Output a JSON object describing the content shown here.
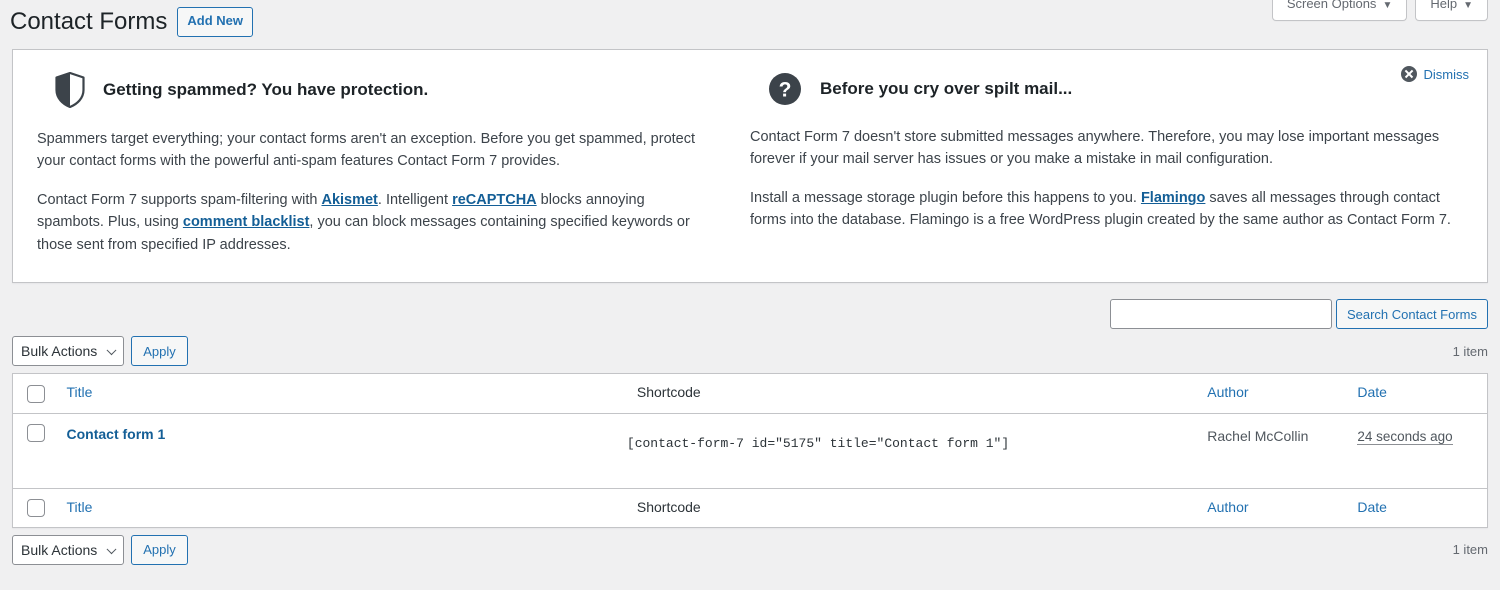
{
  "screen_meta": {
    "screen_options_label": "Screen Options",
    "help_label": "Help",
    "caret": "▼"
  },
  "header": {
    "title": "Contact Forms",
    "add_new_label": "Add New"
  },
  "notice": {
    "dismiss_label": "Dismiss",
    "columns": [
      {
        "icon": "shield-icon",
        "heading": "Getting spammed? You have protection.",
        "paragraphs": [
          {
            "parts": [
              {
                "text": "Spammers target everything; your contact forms aren't an exception. Before you get spammed, protect your contact forms with the powerful anti-spam features Contact Form 7 provides.",
                "link": false
              }
            ]
          },
          {
            "parts": [
              {
                "text": "Contact Form 7 supports spam-filtering with ",
                "link": false
              },
              {
                "text": "Akismet",
                "link": true
              },
              {
                "text": ". Intelligent ",
                "link": false
              },
              {
                "text": "reCAPTCHA",
                "link": true
              },
              {
                "text": " blocks annoying spambots. Plus, using ",
                "link": false
              },
              {
                "text": "comment blacklist",
                "link": true
              },
              {
                "text": ", you can block messages containing specified keywords or those sent from specified IP addresses.",
                "link": false
              }
            ]
          }
        ]
      },
      {
        "icon": "question-mark-icon",
        "heading": "Before you cry over spilt mail...",
        "paragraphs": [
          {
            "parts": [
              {
                "text": "Contact Form 7 doesn't store submitted messages anywhere. Therefore, you may lose important messages forever if your mail server has issues or you make a mistake in mail configuration.",
                "link": false
              }
            ]
          },
          {
            "parts": [
              {
                "text": "Install a message storage plugin before this happens to you. ",
                "link": false
              },
              {
                "text": "Flamingo",
                "link": true
              },
              {
                "text": " saves all messages through contact forms into the database. Flamingo is a free WordPress plugin created by the same author as Contact Form 7.",
                "link": false
              }
            ]
          }
        ]
      }
    ]
  },
  "search": {
    "value": "",
    "placeholder": "",
    "button_label": "Search Contact Forms"
  },
  "tablenav_top": {
    "bulk_actions_label": "Bulk Actions",
    "apply_label": "Apply",
    "displaying_num": "1 item"
  },
  "tablenav_bottom": {
    "bulk_actions_label": "Bulk Actions",
    "apply_label": "Apply",
    "displaying_num": "1 item"
  },
  "table": {
    "columns": {
      "title": "Title",
      "shortcode": "Shortcode",
      "author": "Author",
      "date": "Date"
    },
    "rows": [
      {
        "title": "Contact form 1",
        "shortcode": "[contact-form-7 id=\"5175\" title=\"Contact form 1\"]",
        "author": "Rachel McCollin",
        "date": "24 seconds ago"
      }
    ]
  },
  "colors": {
    "page_bg": "#f0f0f1",
    "link": "#2271b1",
    "link_strong": "#135e96",
    "text": "#3c434a",
    "border": "#c3c4c7",
    "icon_dark": "#3c434a"
  }
}
